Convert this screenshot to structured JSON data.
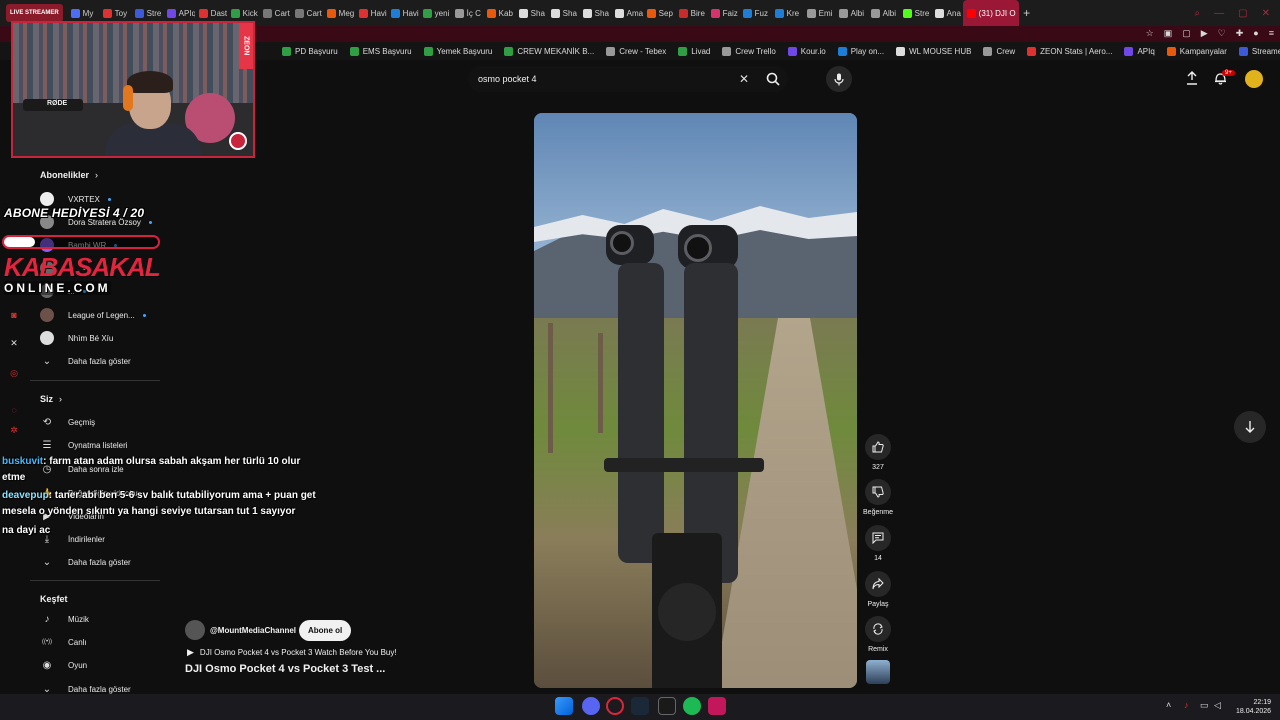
{
  "browser": {
    "tabs": [
      {
        "label": "LIVE STREAMER",
        "color": "#8a1b2a"
      },
      {
        "label": "My",
        "color": "#4c6ef5"
      },
      {
        "label": "Toy",
        "color": "#e03131"
      },
      {
        "label": "Stre",
        "color": "#3b5bdb"
      },
      {
        "label": "APIq",
        "color": "#7048e8"
      },
      {
        "label": "Dast",
        "color": "#e03131"
      },
      {
        "label": "Kick",
        "color": "#2f9e44"
      },
      {
        "label": "Cart",
        "color": "#777777"
      },
      {
        "label": "Cart",
        "color": "#777777"
      },
      {
        "label": "Meg",
        "color": "#e8590c"
      },
      {
        "label": "Havi",
        "color": "#e03131"
      },
      {
        "label": "Havi",
        "color": "#1c7ed6"
      },
      {
        "label": "yeni",
        "color": "#2f9e44"
      },
      {
        "label": "İç C",
        "color": "#999999"
      },
      {
        "label": "Kab",
        "color": "#e8590c"
      },
      {
        "label": "Sha",
        "color": "#dddddd"
      },
      {
        "label": "Sha",
        "color": "#dddddd"
      },
      {
        "label": "Sha",
        "color": "#dddddd"
      },
      {
        "label": "Ama",
        "color": "#dddddd"
      },
      {
        "label": "Sep",
        "color": "#e8590c"
      },
      {
        "label": "Bire",
        "color": "#c92a2a"
      },
      {
        "label": "Faiz",
        "color": "#d6336c"
      },
      {
        "label": "Fuz",
        "color": "#1c7ed6"
      },
      {
        "label": "Kre",
        "color": "#1c7ed6"
      },
      {
        "label": "Emi",
        "color": "#999999"
      },
      {
        "label": "Albi",
        "color": "#999999"
      },
      {
        "label": "Albi",
        "color": "#999999"
      },
      {
        "label": "Stre",
        "color": "#53fc18"
      },
      {
        "label": "Ana",
        "color": "#dddddd"
      },
      {
        "label": "(31) DJI O",
        "color": "#ff0000",
        "active": true
      }
    ],
    "bookmarks": [
      {
        "label": "PD Başvuru",
        "color": "#2f9e44"
      },
      {
        "label": "EMS Başvuru",
        "color": "#2f9e44"
      },
      {
        "label": "Yemek Başvuru",
        "color": "#2f9e44"
      },
      {
        "label": "CREW MEKANİK B...",
        "color": "#2f9e44"
      },
      {
        "label": "Crew - Tebex",
        "color": "#999999"
      },
      {
        "label": "Livad",
        "color": "#2f9e44"
      },
      {
        "label": "Crew Trello",
        "color": "#999999"
      },
      {
        "label": "Kour.io",
        "color": "#7048e8"
      },
      {
        "label": "Play on...",
        "color": "#1c7ed6"
      },
      {
        "label": "WL MOUSE HUB",
        "color": "#dddddd"
      },
      {
        "label": "Crew",
        "color": "#999999"
      },
      {
        "label": "ZEON Stats | Aero...",
        "color": "#e03131"
      },
      {
        "label": "APIq",
        "color": "#7048e8"
      },
      {
        "label": "Kampanyalar",
        "color": "#e8590c"
      },
      {
        "label": "Streamer Panel",
        "color": "#3b5bdb"
      }
    ]
  },
  "webcam": {
    "mic_brand": "RØDE",
    "sponsor": "ZEON"
  },
  "overlay": {
    "gift_goal": "ABONE HEDİYESİ 4 / 20",
    "gift_progress": 0.2,
    "brand": "KABASAKAL",
    "domain": "ONLINE.COM"
  },
  "chat": [
    {
      "user": "buskuvit",
      "text": ": farm atan adam olursa sabah akşam her türlü 10 olur"
    },
    {
      "user": "",
      "text": "etme"
    },
    {
      "user": "deavepup",
      "text": ": taner abi ben 5-6 sv balık tutabiliyorum ama + puan get"
    },
    {
      "user": "",
      "text": "mesela o yönden sıkıntı ya hangi seviye tutarsan tut 1 sayıyor"
    },
    {
      "user": "",
      "text": "na dayi ac"
    }
  ],
  "sidebar": {
    "subscriptions_heading": "Abonelikler",
    "subscriptions": [
      {
        "label": "VXRTEX",
        "color": "#eeeeee"
      },
      {
        "label": "Dora Stratera Özsoy",
        "color": "#888888"
      },
      {
        "label": "Bambi WR",
        "color": "#8a5cf6"
      },
      {
        "label": "...",
        "color": "#666666"
      },
      {
        "label": "...",
        "color": "#666666"
      },
      {
        "label": "League of Legen...",
        "color": "#6c5148"
      },
      {
        "label": "Nhìm Bé Xíu",
        "color": "#dddddd"
      }
    ],
    "show_more": "Daha fazla göster",
    "you_heading": "Siz",
    "you_items": [
      {
        "label": "Geçmiş",
        "icon": "history-icon"
      },
      {
        "label": "Oynatma listeleri",
        "icon": "playlist-icon"
      },
      {
        "label": "Daha sonra izle",
        "icon": "clock-icon"
      },
      {
        "label": "Beğendiğin videolar",
        "icon": "thumb-up-icon"
      },
      {
        "label": "Videoların",
        "icon": "video-icon"
      },
      {
        "label": "İndirilenler",
        "icon": "download-icon"
      }
    ],
    "show_more_2": "Daha fazla göster",
    "explore_heading": "Keşfet",
    "explore_items": [
      {
        "label": "Müzik",
        "icon": "music-icon"
      },
      {
        "label": "Canlı",
        "icon": "live-icon"
      },
      {
        "label": "Oyun",
        "icon": "gaming-icon"
      }
    ],
    "show_more_3": "Daha fazla göster"
  },
  "search": {
    "query": "osmo pocket 4"
  },
  "header": {
    "notifications": "9+"
  },
  "short": {
    "channel": "@MountMediaChannel",
    "subscribe_label": "Abone ol",
    "playlist": "DJI Osmo Pocket 4 vs Pocket 3 Watch Before You Buy!",
    "title": "DJI Osmo Pocket 4 vs Pocket 3 Test ...",
    "likes": "327",
    "dislike_label": "Beğenme",
    "comments": "14",
    "share_label": "Paylaş",
    "remix_label": "Remix"
  },
  "taskbar": {
    "time": "22:19",
    "date": "18.04.2026"
  }
}
